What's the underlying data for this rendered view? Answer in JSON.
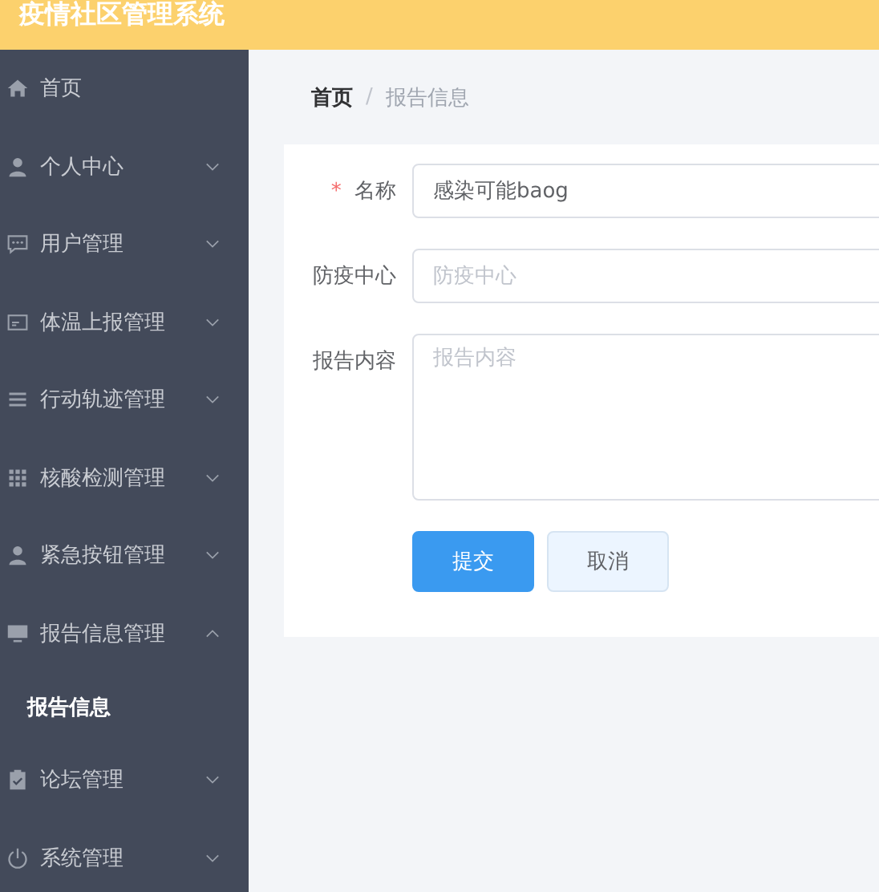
{
  "header": {
    "title": "疫情社区管理系统"
  },
  "sidebar": {
    "items": [
      {
        "label": "首页",
        "selected": false
      },
      {
        "label": "个人中心",
        "selected": false,
        "expanded": false
      },
      {
        "label": "用户管理",
        "selected": false,
        "expanded": false
      },
      {
        "label": "体温上报管理",
        "selected": false,
        "expanded": false
      },
      {
        "label": "行动轨迹管理",
        "selected": false,
        "expanded": false
      },
      {
        "label": "核酸检测管理",
        "selected": false,
        "expanded": false
      },
      {
        "label": "紧急按钮管理",
        "selected": false,
        "expanded": false
      },
      {
        "label": "报告信息管理",
        "selected": false,
        "expanded": true,
        "children": [
          {
            "label": "报告信息",
            "selected": true
          }
        ]
      },
      {
        "label": "论坛管理",
        "selected": false,
        "expanded": false
      },
      {
        "label": "系统管理",
        "selected": false,
        "expanded": false
      }
    ]
  },
  "breadcrumb": {
    "separator": "/",
    "items": [
      "首页",
      "报告信息"
    ]
  },
  "form": {
    "required_mark": "*",
    "fields": [
      {
        "kind": "input",
        "label": "名称",
        "required": true,
        "value": "感染可能baog"
      },
      {
        "kind": "input",
        "label": "防疫中心",
        "required": false,
        "placeholder": "防疫中心"
      },
      {
        "kind": "textarea",
        "label": "报告内容",
        "required": false,
        "placeholder": "报告内容"
      }
    ],
    "buttons": [
      {
        "label": "提交",
        "kind": "primary"
      },
      {
        "label": "取消",
        "kind": "secondary"
      }
    ]
  }
}
